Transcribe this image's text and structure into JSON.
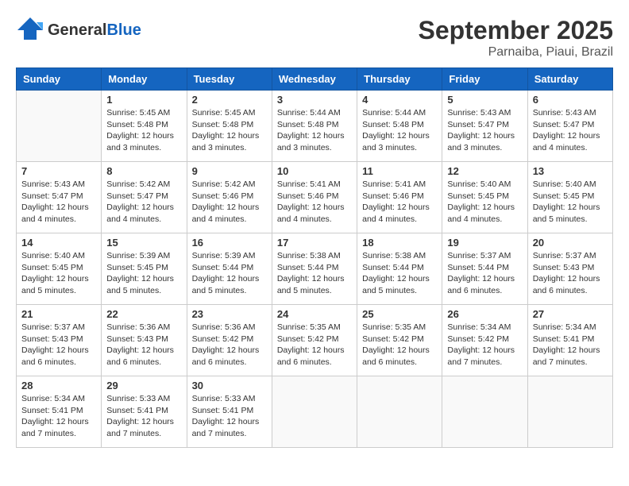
{
  "header": {
    "logo_general": "General",
    "logo_blue": "Blue",
    "month": "September 2025",
    "location": "Parnaiba, Piaui, Brazil"
  },
  "weekdays": [
    "Sunday",
    "Monday",
    "Tuesday",
    "Wednesday",
    "Thursday",
    "Friday",
    "Saturday"
  ],
  "weeks": [
    [
      {
        "day": "",
        "empty": true
      },
      {
        "day": "1",
        "sunrise": "5:45 AM",
        "sunset": "5:48 PM",
        "daylight": "12 hours and 3 minutes."
      },
      {
        "day": "2",
        "sunrise": "5:45 AM",
        "sunset": "5:48 PM",
        "daylight": "12 hours and 3 minutes."
      },
      {
        "day": "3",
        "sunrise": "5:44 AM",
        "sunset": "5:48 PM",
        "daylight": "12 hours and 3 minutes."
      },
      {
        "day": "4",
        "sunrise": "5:44 AM",
        "sunset": "5:48 PM",
        "daylight": "12 hours and 3 minutes."
      },
      {
        "day": "5",
        "sunrise": "5:43 AM",
        "sunset": "5:47 PM",
        "daylight": "12 hours and 3 minutes."
      },
      {
        "day": "6",
        "sunrise": "5:43 AM",
        "sunset": "5:47 PM",
        "daylight": "12 hours and 4 minutes."
      }
    ],
    [
      {
        "day": "7",
        "sunrise": "5:43 AM",
        "sunset": "5:47 PM",
        "daylight": "12 hours and 4 minutes."
      },
      {
        "day": "8",
        "sunrise": "5:42 AM",
        "sunset": "5:47 PM",
        "daylight": "12 hours and 4 minutes."
      },
      {
        "day": "9",
        "sunrise": "5:42 AM",
        "sunset": "5:46 PM",
        "daylight": "12 hours and 4 minutes."
      },
      {
        "day": "10",
        "sunrise": "5:41 AM",
        "sunset": "5:46 PM",
        "daylight": "12 hours and 4 minutes."
      },
      {
        "day": "11",
        "sunrise": "5:41 AM",
        "sunset": "5:46 PM",
        "daylight": "12 hours and 4 minutes."
      },
      {
        "day": "12",
        "sunrise": "5:40 AM",
        "sunset": "5:45 PM",
        "daylight": "12 hours and 4 minutes."
      },
      {
        "day": "13",
        "sunrise": "5:40 AM",
        "sunset": "5:45 PM",
        "daylight": "12 hours and 5 minutes."
      }
    ],
    [
      {
        "day": "14",
        "sunrise": "5:40 AM",
        "sunset": "5:45 PM",
        "daylight": "12 hours and 5 minutes."
      },
      {
        "day": "15",
        "sunrise": "5:39 AM",
        "sunset": "5:45 PM",
        "daylight": "12 hours and 5 minutes."
      },
      {
        "day": "16",
        "sunrise": "5:39 AM",
        "sunset": "5:44 PM",
        "daylight": "12 hours and 5 minutes."
      },
      {
        "day": "17",
        "sunrise": "5:38 AM",
        "sunset": "5:44 PM",
        "daylight": "12 hours and 5 minutes."
      },
      {
        "day": "18",
        "sunrise": "5:38 AM",
        "sunset": "5:44 PM",
        "daylight": "12 hours and 5 minutes."
      },
      {
        "day": "19",
        "sunrise": "5:37 AM",
        "sunset": "5:44 PM",
        "daylight": "12 hours and 6 minutes."
      },
      {
        "day": "20",
        "sunrise": "5:37 AM",
        "sunset": "5:43 PM",
        "daylight": "12 hours and 6 minutes."
      }
    ],
    [
      {
        "day": "21",
        "sunrise": "5:37 AM",
        "sunset": "5:43 PM",
        "daylight": "12 hours and 6 minutes."
      },
      {
        "day": "22",
        "sunrise": "5:36 AM",
        "sunset": "5:43 PM",
        "daylight": "12 hours and 6 minutes."
      },
      {
        "day": "23",
        "sunrise": "5:36 AM",
        "sunset": "5:42 PM",
        "daylight": "12 hours and 6 minutes."
      },
      {
        "day": "24",
        "sunrise": "5:35 AM",
        "sunset": "5:42 PM",
        "daylight": "12 hours and 6 minutes."
      },
      {
        "day": "25",
        "sunrise": "5:35 AM",
        "sunset": "5:42 PM",
        "daylight": "12 hours and 6 minutes."
      },
      {
        "day": "26",
        "sunrise": "5:34 AM",
        "sunset": "5:42 PM",
        "daylight": "12 hours and 7 minutes."
      },
      {
        "day": "27",
        "sunrise": "5:34 AM",
        "sunset": "5:41 PM",
        "daylight": "12 hours and 7 minutes."
      }
    ],
    [
      {
        "day": "28",
        "sunrise": "5:34 AM",
        "sunset": "5:41 PM",
        "daylight": "12 hours and 7 minutes."
      },
      {
        "day": "29",
        "sunrise": "5:33 AM",
        "sunset": "5:41 PM",
        "daylight": "12 hours and 7 minutes."
      },
      {
        "day": "30",
        "sunrise": "5:33 AM",
        "sunset": "5:41 PM",
        "daylight": "12 hours and 7 minutes."
      },
      {
        "day": "",
        "empty": true
      },
      {
        "day": "",
        "empty": true
      },
      {
        "day": "",
        "empty": true
      },
      {
        "day": "",
        "empty": true
      }
    ]
  ],
  "labels": {
    "sunrise_label": "Sunrise:",
    "sunset_label": "Sunset:",
    "daylight_label": "Daylight:"
  }
}
